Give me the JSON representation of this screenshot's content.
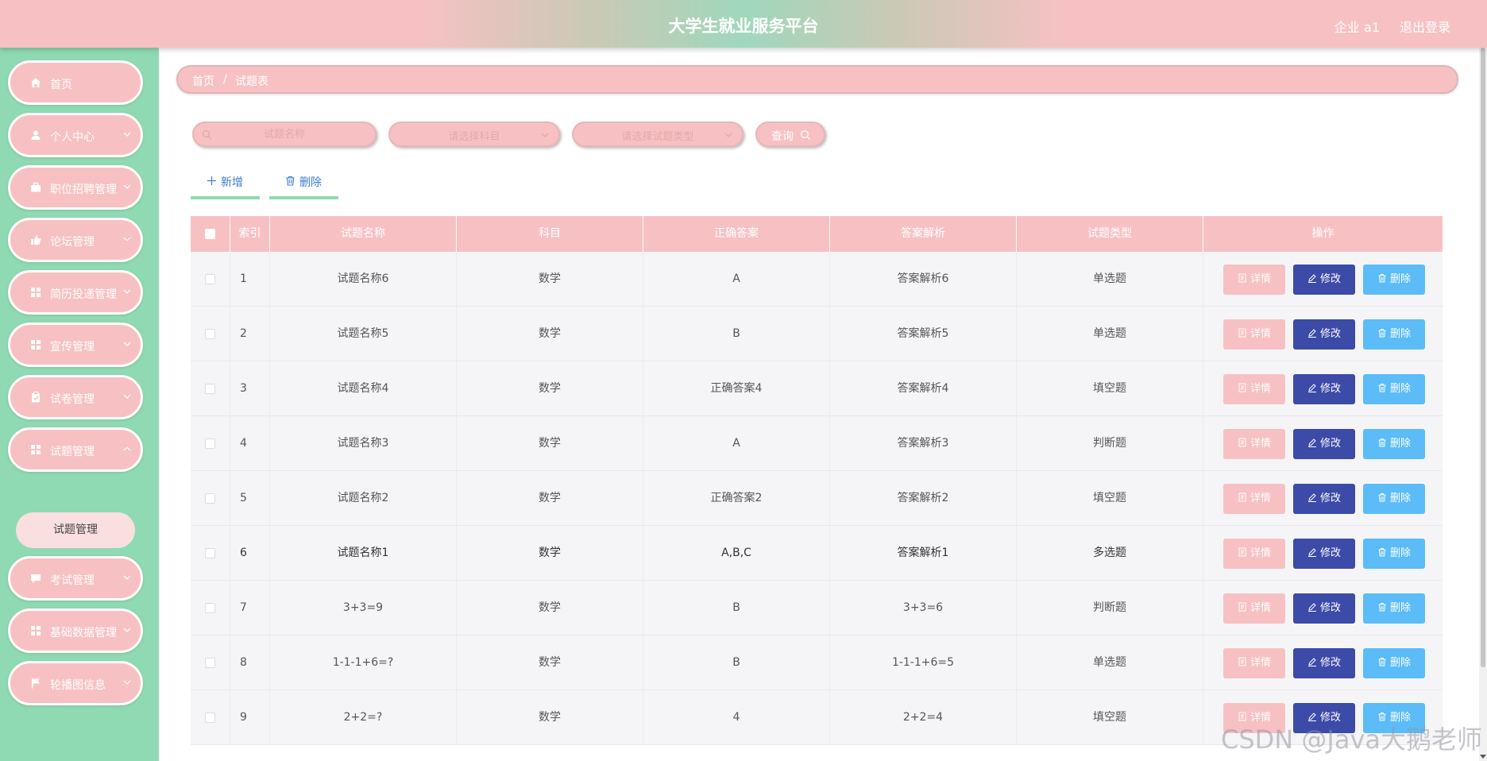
{
  "header": {
    "title": "大学生就业服务平台",
    "user": "企业 a1",
    "logout": "退出登录"
  },
  "sidebar": {
    "items": [
      {
        "label": "首页",
        "icon": "home-icon"
      },
      {
        "label": "个人中心",
        "icon": "user-icon"
      },
      {
        "label": "职位招聘管理",
        "icon": "briefcase-icon"
      },
      {
        "label": "论坛管理",
        "icon": "thumb-icon"
      },
      {
        "label": "简历投递管理",
        "icon": "grid-icon"
      },
      {
        "label": "宣传管理",
        "icon": "grid-icon"
      },
      {
        "label": "试卷管理",
        "icon": "clipboard-icon"
      },
      {
        "label": "试题管理",
        "icon": "grid-icon"
      },
      {
        "label": "考试管理",
        "icon": "message-icon"
      },
      {
        "label": "基础数据管理",
        "icon": "grid-icon"
      },
      {
        "label": "轮播图信息",
        "icon": "flag-icon"
      }
    ],
    "submenu": "试题管理"
  },
  "breadcrumb": {
    "home": "首页",
    "separator": "/",
    "current": "试题表"
  },
  "search": {
    "name_placeholder": "试题名称",
    "subject_placeholder": "请选择科目",
    "type_placeholder": "请选择试题类型",
    "query_label": "查询"
  },
  "actions": {
    "add_label": "新增",
    "delete_label": "删除"
  },
  "table": {
    "headers": [
      "索引",
      "试题名称",
      "科目",
      "正确答案",
      "答案解析",
      "试题类型",
      "操作"
    ],
    "detail_label": "详情",
    "edit_label": "修改",
    "delete_label": "删除",
    "rows": [
      [
        "1",
        "试题名称6",
        "数学",
        "A",
        "答案解析6",
        "单选题"
      ],
      [
        "2",
        "试题名称5",
        "数学",
        "B",
        "答案解析5",
        "单选题"
      ],
      [
        "3",
        "试题名称4",
        "数学",
        "正确答案4",
        "答案解析4",
        "填空题"
      ],
      [
        "4",
        "试题名称3",
        "数学",
        "A",
        "答案解析3",
        "判断题"
      ],
      [
        "5",
        "试题名称2",
        "数学",
        "正确答案2",
        "答案解析2",
        "填空题"
      ],
      [
        "6",
        "试题名称1",
        "数学",
        "A,B,C",
        "答案解析1",
        "多选题"
      ],
      [
        "7",
        "3+3=9",
        "数学",
        "B",
        "3+3=6",
        "判断题"
      ],
      [
        "8",
        "1-1-1+6=?",
        "数学",
        "B",
        "1-1-1+6=5",
        "单选题"
      ],
      [
        "9",
        "2+2=?",
        "数学",
        "4",
        "2+2=4",
        "填空题"
      ]
    ]
  },
  "watermark": "CSDN @Java大鹅老师"
}
